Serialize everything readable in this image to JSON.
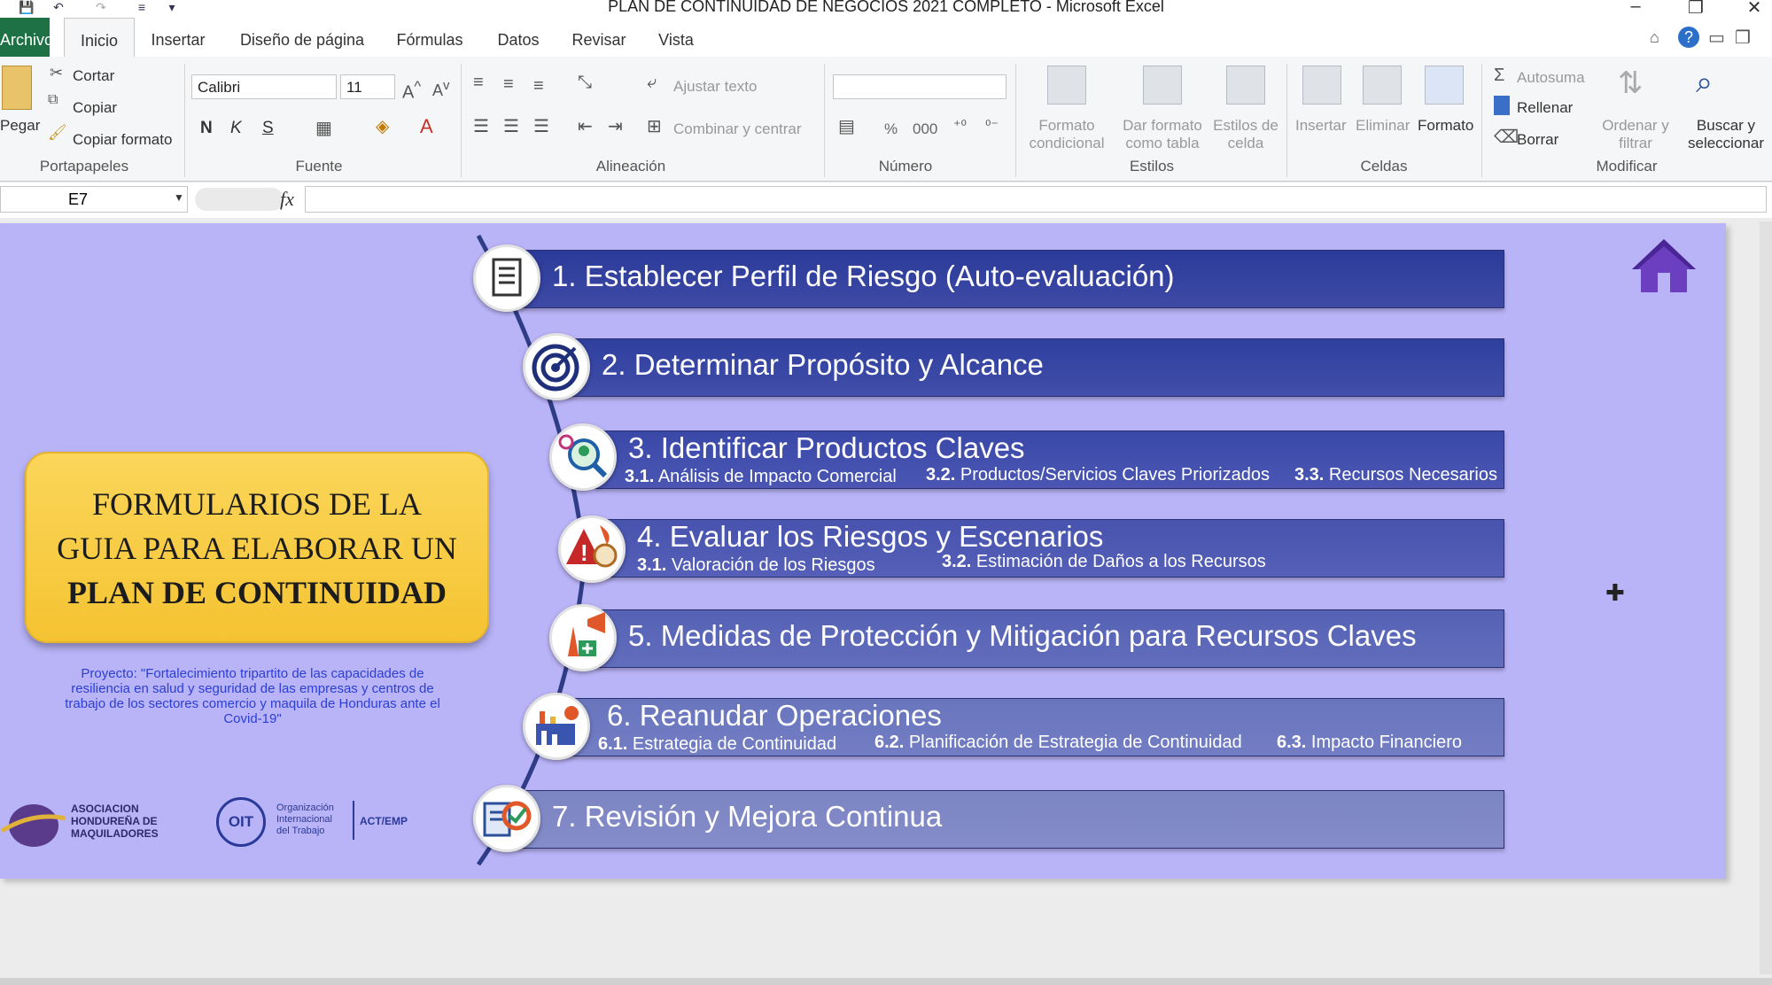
{
  "window": {
    "title": "PLAN DE CONTINUIDAD DE NEGOCIOS 2021 COMPLETO  -  Microsoft Excel"
  },
  "tabs": [
    {
      "label": "Archivo"
    },
    {
      "label": "Inicio"
    },
    {
      "label": "Insertar"
    },
    {
      "label": "Diseño de página"
    },
    {
      "label": "Fórmulas"
    },
    {
      "label": "Datos"
    },
    {
      "label": "Revisar"
    },
    {
      "label": "Vista"
    }
  ],
  "ribbon": {
    "clipboard": {
      "paste": "Pegar",
      "cut": "Cortar",
      "copy": "Copiar",
      "format_painter": "Copiar formato",
      "label": "Portapapeles"
    },
    "font": {
      "name": "Calibri",
      "size": "11",
      "bold": "N",
      "italic": "K",
      "underline": "S",
      "color_a": "A",
      "label": "Fuente"
    },
    "alignment": {
      "wrap": "Ajustar texto",
      "merge": "Combinar y centrar",
      "label": "Alineación"
    },
    "number": {
      "percent": "%",
      "thousands": "000",
      "label": "Número"
    },
    "styles": {
      "conditional": "Formato condicional",
      "as_table": "Dar formato como tabla",
      "cell_styles": "Estilos de celda",
      "label": "Estilos"
    },
    "cells": {
      "insert": "Insertar",
      "delete": "Eliminar",
      "format": "Formato",
      "label": "Celdas"
    },
    "editing": {
      "autosum": "Autosuma",
      "fill": "Rellenar",
      "clear": "Borrar",
      "sort": "Ordenar y filtrar",
      "find": "Buscar y seleccionar",
      "label": "Modificar"
    }
  },
  "formula_bar": {
    "name_box": "E7",
    "fx": "fx",
    "value": ""
  },
  "sheet": {
    "yellow_box": {
      "line1": "FORMULARIOS DE LA",
      "line2": "GUIA PARA ELABORAR UN",
      "line3": "PLAN DE CONTINUIDAD"
    },
    "project": {
      "line1": "Proyecto: \"Fortalecimiento  tripartito de las capacidades de",
      "line2": "resiliencia  en salud y seguridad de las empresas y centros de",
      "line3": "trabajo de los sectores comercio y maquila  de Honduras ante el",
      "line4": "Covid-19\""
    },
    "logos": {
      "ahm": {
        "line1": "ASOCIACION",
        "line2": "HONDUREÑA DE",
        "line3": "MAQUILADORES"
      },
      "oit": {
        "mark": "OIT",
        "line1": "Organización",
        "line2": "Internacional",
        "line3": "del Trabajo",
        "actemp": "ACT/EMP"
      }
    },
    "steps": [
      {
        "title": "1. Establecer Perfil de Riesgo (Auto-evaluación)",
        "color": "#2b3a99",
        "icon": "checklist-icon",
        "subs": []
      },
      {
        "title": "2. Determinar  Propósito y Alcance",
        "color": "#2f3f9e",
        "icon": "target-icon",
        "subs": []
      },
      {
        "title": "3. Identificar Productos Claves",
        "color": "#3a48a8",
        "icon": "magnifier-people-icon",
        "subs": [
          {
            "num": "3.1.",
            "text": "Análisis de Impacto Comercial"
          },
          {
            "num": "3.2.",
            "text": "Productos/Servicios Claves Priorizados"
          },
          {
            "num": "3.3.",
            "text": "Recursos Necesarios"
          }
        ]
      },
      {
        "title": "4. Evaluar los Riesgos  y Escenarios",
        "color": "#4753ae",
        "icon": "risk-alert-icon",
        "subs": [
          {
            "num": "3.1.",
            "text": "Valoración de los Riesgos"
          },
          {
            "num": "3.2.",
            "text": "Estimación de Daños a los Recursos"
          }
        ]
      },
      {
        "title": "5. Medidas de Protección y Mitigación para Recursos Claves",
        "color": "#5562b4",
        "icon": "protection-icon",
        "subs": []
      },
      {
        "title": "6. Reanudar  Operaciones",
        "color": "#6875bc",
        "icon": "factory-icon",
        "subs": [
          {
            "num": "6.1.",
            "text": "Estrategia de Continuidad"
          },
          {
            "num": "6.2.",
            "text": "Planificación de Estrategia de Continuidad"
          },
          {
            "num": "6.3.",
            "text": "Impacto Financiero"
          }
        ]
      },
      {
        "title": "7. Revisión  y Mejora Continua",
        "color": "#7c86c2",
        "icon": "review-icon",
        "subs": []
      }
    ]
  }
}
